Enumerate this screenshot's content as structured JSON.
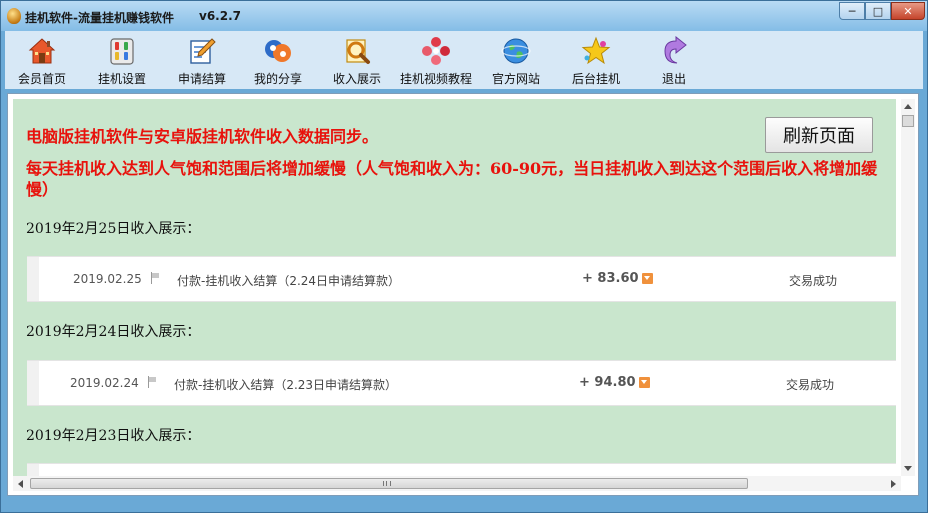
{
  "window": {
    "title": "挂机软件-流量挂机赚钱软件",
    "version": "v6.2.7",
    "controls": {
      "minimize": "─",
      "maximize": "□",
      "close": "✕"
    }
  },
  "toolbar": {
    "items": [
      {
        "label": "会员首页",
        "icon": "home-icon"
      },
      {
        "label": "挂机设置",
        "icon": "settings-panel-icon"
      },
      {
        "label": "申请结算",
        "icon": "edit-document-icon"
      },
      {
        "label": "我的分享",
        "icon": "share-icon"
      },
      {
        "label": "收入展示",
        "icon": "search-document-icon"
      },
      {
        "label": "挂机视频教程",
        "icon": "video-tutorial-icon"
      },
      {
        "label": "官方网站",
        "icon": "globe-icon"
      },
      {
        "label": "后台挂机",
        "icon": "star-icon"
      },
      {
        "label": "退出",
        "icon": "exit-arrow-icon"
      }
    ]
  },
  "content": {
    "notice_sync": "电脑版挂机软件与安卓版挂机软件收入数据同步。",
    "notice_limit": "每天挂机收入达到人气饱和范围后将增加缓慢（人气饱和收入为：60-90元，当日挂机收入到达这个范围后收入将增加缓慢）",
    "refresh_label": "刷新页面",
    "days": [
      {
        "heading": "2019年2月25日收入展示：",
        "record": {
          "date": "2019.02.25",
          "description": "付款-挂机收入结算（2.24日申请结算款）",
          "amount": "+ 83.60",
          "status": "交易成功"
        }
      },
      {
        "heading": "2019年2月24日收入展示：",
        "record": {
          "date": "2019.02.24",
          "description": "付款-挂机收入结算（2.23日申请结算款）",
          "amount": "+ 94.80",
          "status": "交易成功"
        }
      },
      {
        "heading": "2019年2月23日收入展示：",
        "record": null
      }
    ]
  },
  "colors": {
    "title_bar": "#a6cdec",
    "toolbar_bg": "#d7e8f6",
    "content_bg": "#c9e6cd",
    "notice_text": "#e8120c",
    "expand_badge": "#f0913c"
  }
}
